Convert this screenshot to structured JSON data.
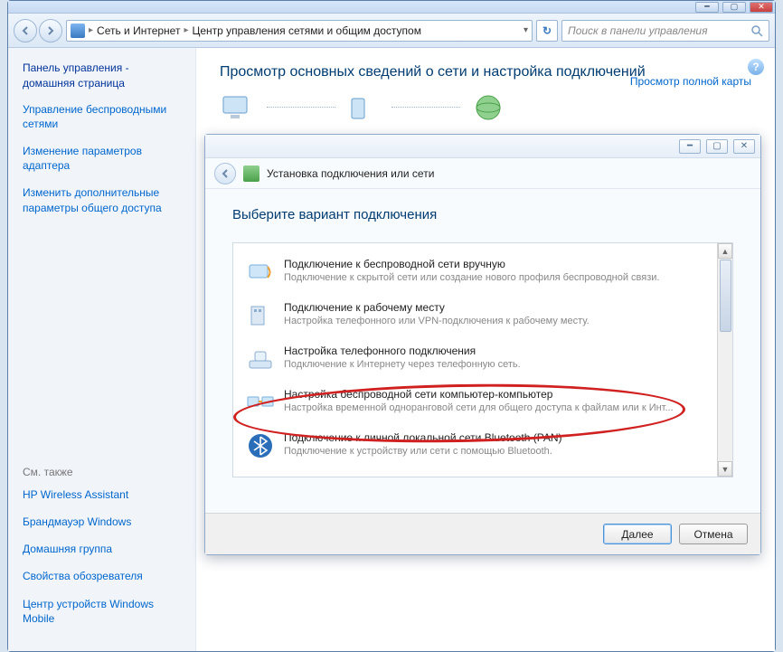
{
  "titlebar": {},
  "breadcrumb": {
    "seg1": "Сеть и Интернет",
    "seg2": "Центр управления сетями и общим доступом"
  },
  "search": {
    "placeholder": "Поиск в панели управления"
  },
  "sidebar": {
    "home1": "Панель управления -",
    "home2": "домашняя страница",
    "links": [
      "Управление беспроводными сетями",
      "Изменение параметров адаптера",
      "Изменить дополнительные параметры общего доступа"
    ],
    "see_also_label": "См. также",
    "see_also": [
      "HP Wireless Assistant",
      "Брандмауэр Windows",
      "Домашняя группа",
      "Свойства обозревателя",
      "Центр устройств Windows Mobile"
    ]
  },
  "main": {
    "heading": "Просмотр основных сведений о сети и настройка подключений",
    "map_link": "Просмотр полной карты"
  },
  "dialog": {
    "header": "Установка подключения или сети",
    "heading": "Выберите вариант подключения",
    "options": [
      {
        "title": "Подключение к беспроводной сети вручную",
        "desc": "Подключение к скрытой сети или создание нового профиля беспроводной связи."
      },
      {
        "title": "Подключение к рабочему месту",
        "desc": "Настройка телефонного или VPN-подключения к рабочему месту."
      },
      {
        "title": "Настройка телефонного подключения",
        "desc": "Подключение к Интернету через телефонную сеть."
      },
      {
        "title": "Настройка беспроводной сети компьютер-компьютер",
        "desc": "Настройка временной одноранговой сети для общего доступа к файлам или к Инт..."
      },
      {
        "title": "Подключение к личной локальной сети Bluetooth (PAN)",
        "desc": "Подключение к устройству или сети с помощью Bluetooth."
      }
    ],
    "btn_next": "Далее",
    "btn_cancel": "Отмена"
  }
}
